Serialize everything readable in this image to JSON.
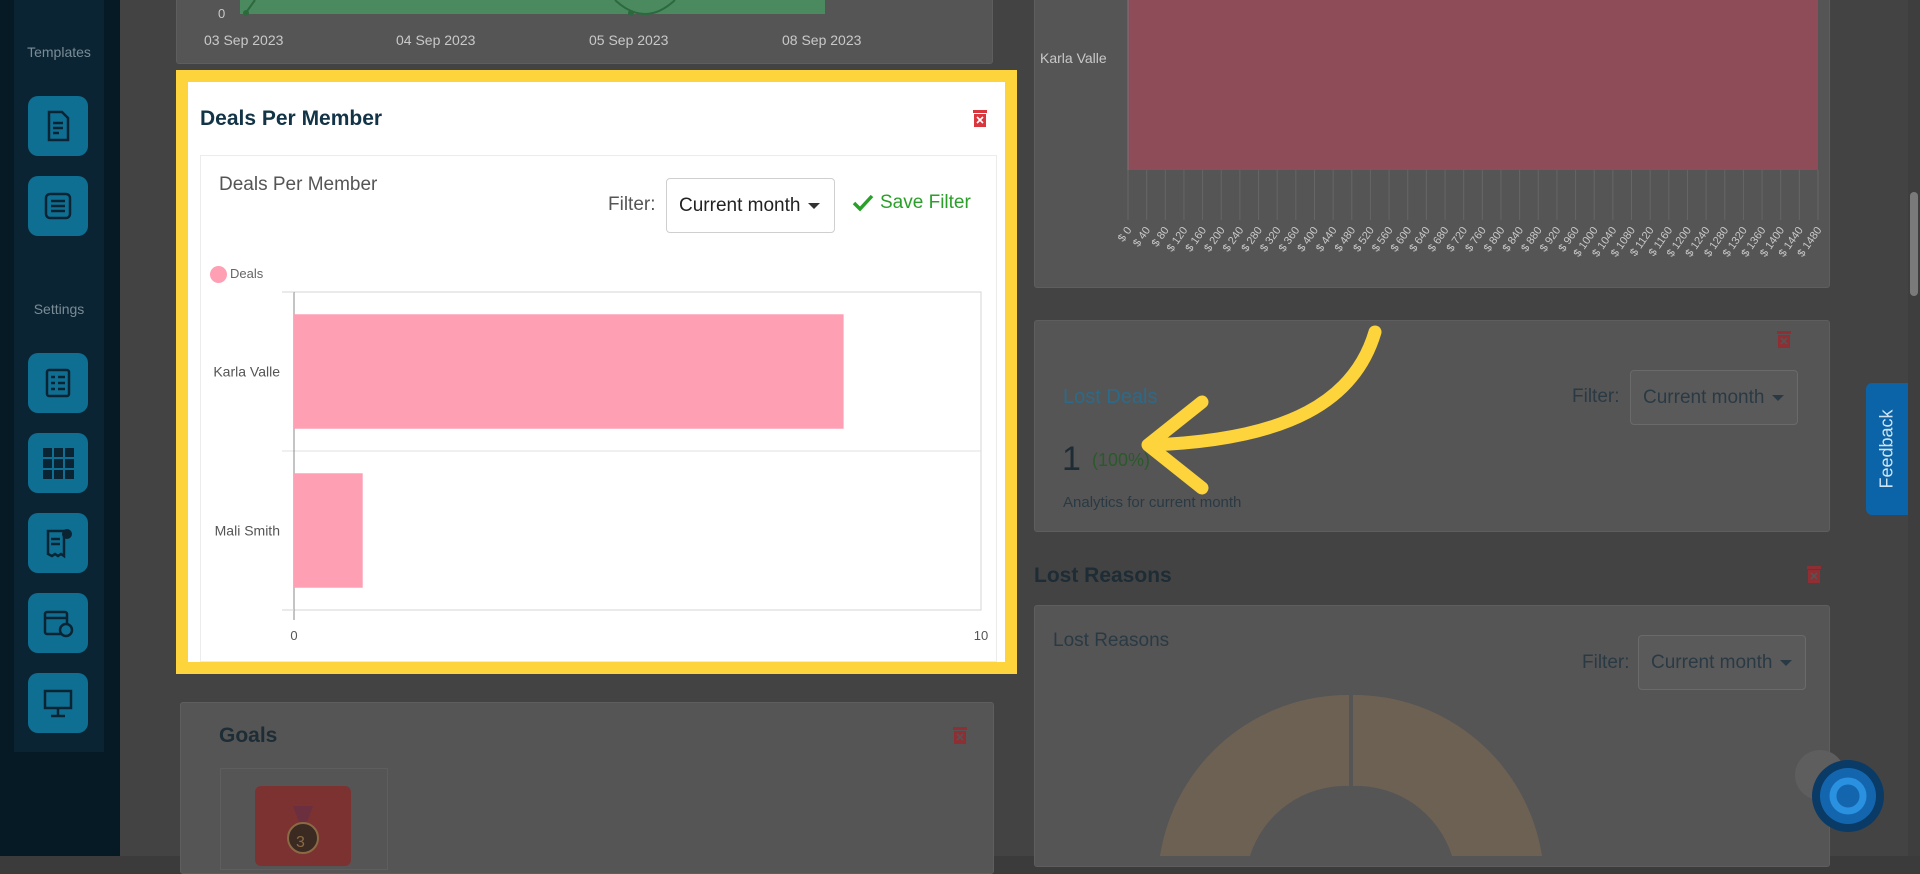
{
  "sidebar": {
    "templates_heading": "Templates",
    "settings_heading": "Settings",
    "template_buttons": [
      {
        "icon": "document-edit-icon"
      },
      {
        "icon": "template-list-icon"
      }
    ],
    "settings_buttons": [
      {
        "icon": "form-checklist-icon"
      },
      {
        "icon": "grid-apps-icon"
      },
      {
        "icon": "invoice-dollar-icon"
      },
      {
        "icon": "calendar-clock-icon"
      },
      {
        "icon": "presentation-monitor-icon"
      }
    ]
  },
  "top_chart": {
    "zero_label": "0",
    "dates": [
      "03 Sep 2023",
      "04 Sep 2023",
      "05 Sep 2023",
      "08 Sep 2023"
    ]
  },
  "deals_per_member": {
    "card_title": "Deals Per Member",
    "chart_title": "Deals Per Member",
    "filter_label": "Filter:",
    "filter_value": "Current month",
    "save_filter_label": "Save Filter",
    "legend_label": "Deals",
    "bar_color": "#ff9fb3"
  },
  "chart_data": {
    "type": "bar",
    "orientation": "horizontal",
    "categories": [
      "Karla Valle",
      "Mali Smith"
    ],
    "series": [
      {
        "name": "Deals",
        "values": [
          8,
          1
        ]
      }
    ],
    "xlim": [
      0,
      10
    ],
    "x_ticks": [
      "0",
      "10"
    ],
    "legend": "top-left",
    "grid": true
  },
  "right_chart": {
    "member_label": "Karla Valle",
    "x_ticks": [
      "$ 0",
      "$ 40",
      "$ 80",
      "$ 120",
      "$ 160",
      "$ 200",
      "$ 240",
      "$ 280",
      "$ 320",
      "$ 360",
      "$ 400",
      "$ 440",
      "$ 480",
      "$ 520",
      "$ 560",
      "$ 600",
      "$ 640",
      "$ 680",
      "$ 720",
      "$ 760",
      "$ 800",
      "$ 840",
      "$ 880",
      "$ 920",
      "$ 960",
      "$ 1000",
      "$ 1040",
      "$ 1080",
      "$ 1120",
      "$ 1160",
      "$ 1200",
      "$ 1240",
      "$ 1280",
      "$ 1320",
      "$ 1360",
      "$ 1400",
      "$ 1440",
      "$ 1480"
    ]
  },
  "lost_deals": {
    "title": "Lost Deals",
    "filter_label": "Filter:",
    "filter_value": "Current month",
    "count": "1",
    "percent": "(100%)",
    "caption": "Analytics for current month"
  },
  "lost_reasons": {
    "card_title": "Lost Reasons",
    "chart_title": "Lost Reasons",
    "filter_label": "Filter:",
    "filter_value": "Current month"
  },
  "goals": {
    "title": "Goals",
    "badge_number": "3"
  },
  "feedback_label": "Feedback",
  "colors": {
    "highlight": "#fdd43b",
    "accent_blue": "#0f6f92",
    "save_green": "#2aa02a",
    "trash_red": "#d9363e",
    "arrow_yellow": "#fdd43b"
  }
}
